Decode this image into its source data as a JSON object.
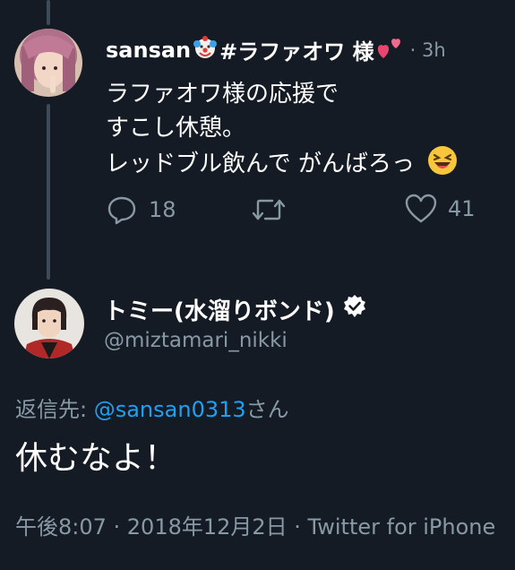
{
  "tweet1": {
    "display_name": "sansan",
    "name_suffix": "#ラファオワ 様",
    "time_sep": "· 3h",
    "lines": [
      "ラファオワ様の応援で",
      "すこし休憩。",
      "レッドブル飲んで がんばろっ"
    ],
    "reply_count": "18",
    "like_count": "41"
  },
  "tweet2": {
    "display_name": "トミー(水溜りボンド)",
    "handle": "@miztamari_nikki",
    "reply_prefix": "返信先: ",
    "reply_mention": "@sansan0313",
    "reply_suffix": "さん",
    "text": "休むなよ！",
    "timestamp": "午後8:07 · 2018年12月2日 · Twitter for iPhone"
  },
  "colors": {
    "background": "#151b24",
    "muted": "#8899a6",
    "link": "#1da1f2",
    "thread_line": "#3d4a57"
  },
  "icons": [
    "clown-face-icon",
    "two-hearts-icon",
    "reply-icon",
    "retweet-icon",
    "like-icon",
    "laughing-face-icon",
    "verified-badge-icon"
  ]
}
